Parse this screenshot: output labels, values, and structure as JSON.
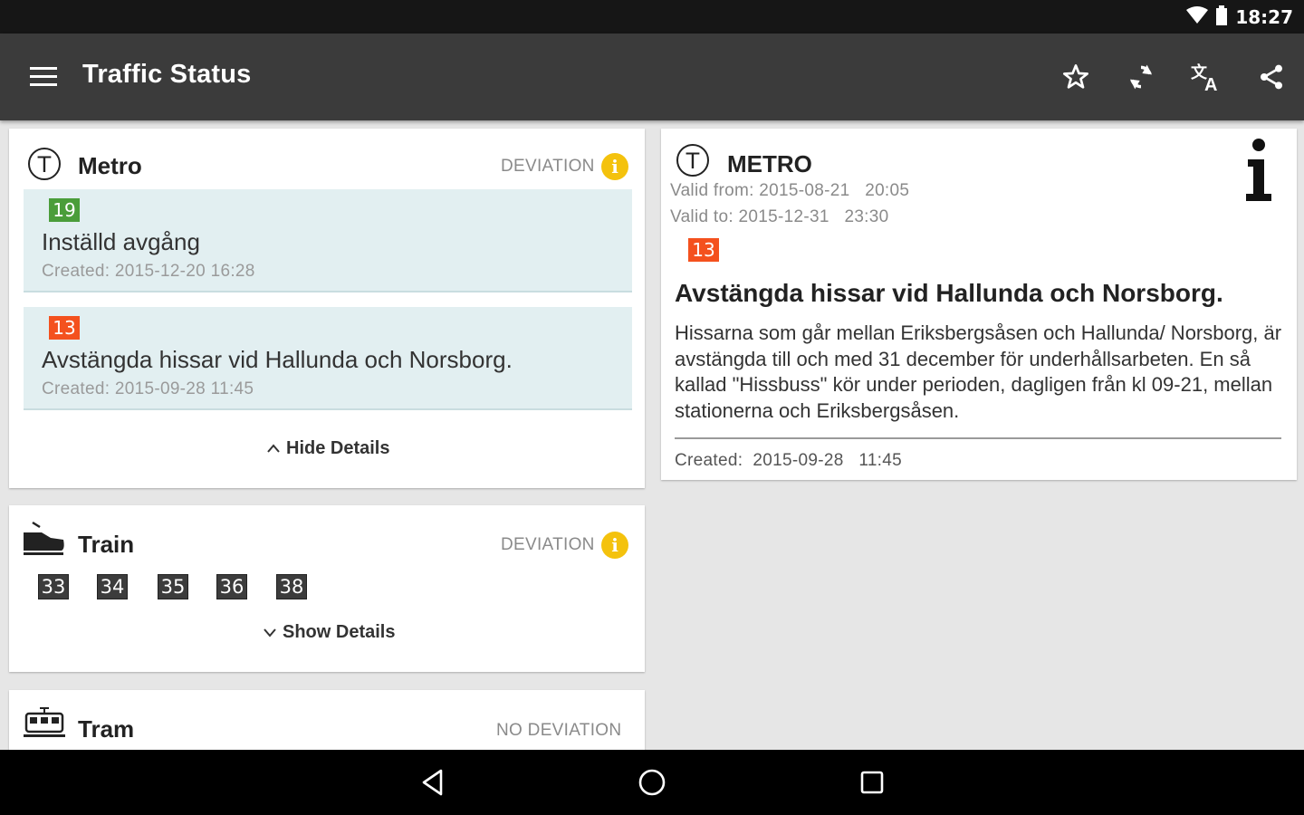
{
  "status_bar": {
    "time": "18:27"
  },
  "app_bar": {
    "title": "Traffic Status",
    "actions": [
      "star-icon",
      "refresh-icon",
      "translate-icon",
      "share-icon"
    ]
  },
  "colors": {
    "app_bar": "#3b3b3b",
    "deviation_item_bg": "#e2eff1",
    "badge_green": "#4a9d3a",
    "badge_orange": "#f4511e",
    "info_yellow": "#f4c20d"
  },
  "metro_card": {
    "title": "Metro",
    "status": "DEVIATION",
    "items": [
      {
        "line": "19",
        "line_color": "#4a9d3a",
        "title": "Inställd avgång",
        "created": "Created:  2015-12-20 16:28"
      },
      {
        "line": "13",
        "line_color": "#f4511e",
        "title": "Avstängda hissar vid Hallunda och Norsborg.",
        "created": "Created:  2015-09-28 11:45"
      }
    ],
    "toggle": "Hide Details"
  },
  "train_card": {
    "title": "Train",
    "status": "DEVIATION",
    "lines": [
      "33",
      "34",
      "35",
      "36",
      "38"
    ],
    "toggle": "Show Details"
  },
  "tram_card": {
    "title": "Tram",
    "status": "NO DEVIATION"
  },
  "detail": {
    "mode": "METRO",
    "valid_from": "Valid from: 2015-08-21   20:05",
    "valid_to": "Valid to: 2015-12-31   23:30",
    "line": "13",
    "title": "Avstängda hissar vid Hallunda och Norsborg.",
    "description": "Hissarna som går mellan Eriksbergsåsen och Hallunda/ Norsborg, är avstängda till och med 31 december för underhållsarbeten. En så kallad \"Hissbuss\" kör under perioden, dagligen från kl 09-21, mellan stationerna och Eriksbergsåsen.",
    "created": "Created:  2015-09-28   11:45"
  }
}
